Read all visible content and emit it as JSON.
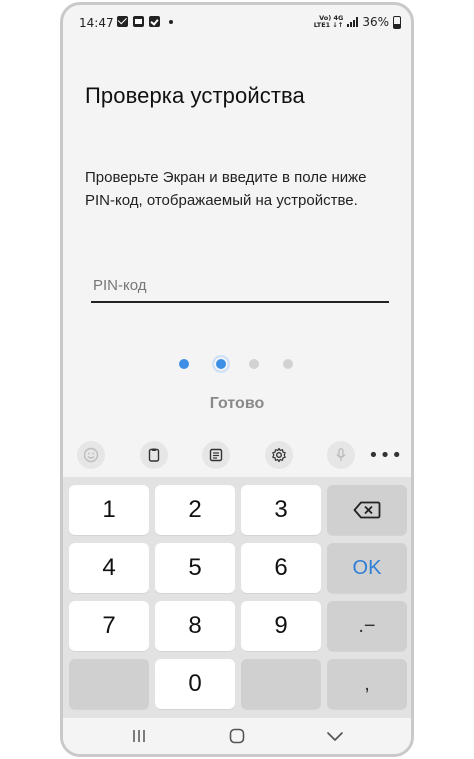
{
  "status_bar": {
    "time": "14:47",
    "network_label_top": "Vo) 4G",
    "network_label_bottom": "LTE1 ↓↑",
    "battery": "36%"
  },
  "screen": {
    "title": "Проверка устройства",
    "description": "Проверьте Экран и введите в поле ниже PIN-код, отображаемый на устройстве.",
    "pin_placeholder": "PIN-код",
    "done_label": "Готово"
  },
  "pager": {
    "count": 4,
    "active_index": 1
  },
  "keyboard": {
    "toolbar_icons": [
      "emoji-icon",
      "clipboard-icon",
      "text-mode-icon",
      "settings-gear-icon",
      "microphone-icon",
      "more-options-icon"
    ],
    "more_label": "•••",
    "keys": {
      "k1": "1",
      "k2": "2",
      "k3": "3",
      "k4": "4",
      "k5": "5",
      "k6": "6",
      "k7": "7",
      "k8": "8",
      "k9": "9",
      "k0": "0",
      "ok": "OK",
      "dot_minus": ".−",
      "comma": ","
    }
  },
  "colors": {
    "accent": "#3d8fe6",
    "ok_text": "#2f7fd6",
    "background": "#f4f4f4",
    "keyboard_bg": "#e2e2e2"
  }
}
